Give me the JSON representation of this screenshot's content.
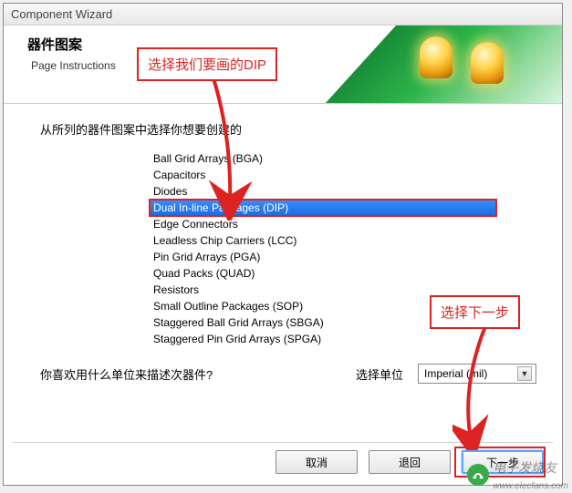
{
  "window": {
    "title": "Component Wizard"
  },
  "header": {
    "title": "器件图案",
    "subtitle": "Page Instructions"
  },
  "annotations": {
    "callout1": "选择我们要画的DIP",
    "callout2": "选择下一步"
  },
  "content": {
    "prompt": "从所列的器件图案中选择你想要创建的",
    "list": [
      "Ball Grid Arrays (BGA)",
      "Capacitors",
      "Diodes",
      "Dual In-line Packages (DIP)",
      "Edge Connectors",
      "Leadless Chip Carriers (LCC)",
      "Pin Grid Arrays (PGA)",
      "Quad Packs (QUAD)",
      "Resistors",
      "Small Outline Packages (SOP)",
      "Staggered Ball Grid Arrays (SBGA)",
      "Staggered Pin Grid Arrays (SPGA)"
    ],
    "selected_index": 3,
    "unit_prompt": "你喜欢用什么单位来描述次器件?",
    "unit_label": "选择单位",
    "unit_value": "Imperial (mil)"
  },
  "buttons": {
    "cancel": "取消",
    "back": "退回",
    "next": "下一步"
  },
  "watermark": {
    "text": "电子发烧友",
    "url": "www.elecfans.com"
  }
}
